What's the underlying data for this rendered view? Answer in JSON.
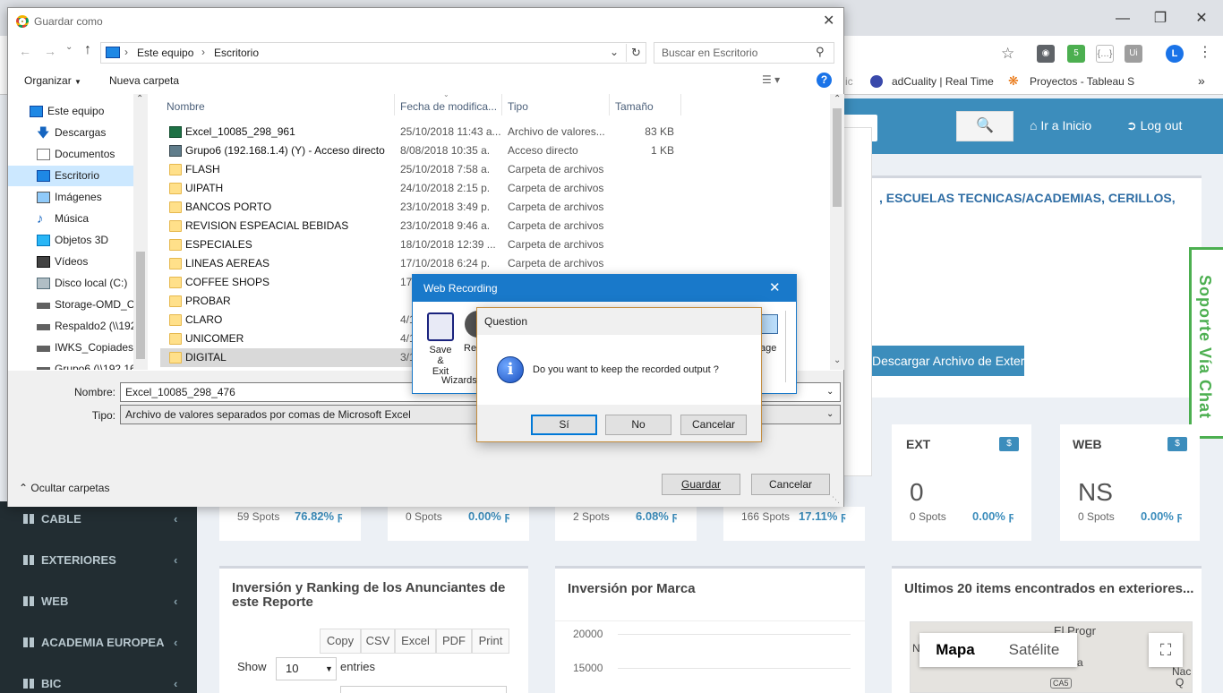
{
  "browser": {
    "bookmarks": [
      "ic",
      "adCuality | Real Time",
      "Proyectos - Tableau S"
    ],
    "extension_badge": "5",
    "profile_initial": "L",
    "nav_home": "Ir a Inicio",
    "nav_logout": "Log out"
  },
  "site": {
    "categories_text": ", ESCUELAS TECNICAS/ACADEMIAS, CERILLOS,",
    "download_button": "Descargar Archivo de Exter",
    "chat_label": "Soporte Vía Chat",
    "sidebar": [
      "CABLE",
      "EXTERIORES",
      "WEB",
      "ACADEMIA EUROPEA",
      "BIC"
    ],
    "stats": [
      {
        "spots": "59 Spots",
        "pct": "76.82%"
      },
      {
        "spots": "0 Spots",
        "pct": "0.00%"
      },
      {
        "spots": "2 Spots",
        "pct": "6.08%"
      },
      {
        "spots": "166 Spots",
        "pct": "17.11%"
      }
    ],
    "ext_card": {
      "title": "EXT",
      "badge": "$",
      "value": "0",
      "spots": "0 Spots",
      "pct": "0.00%"
    },
    "web_card": {
      "title": "WEB",
      "badge": "$",
      "value": "NS",
      "spots": "0 Spots",
      "pct": "0.00%"
    },
    "panel1_title": "Inversión y Ranking de los Anunciantes de este Reporte",
    "export_buttons": [
      "Copy",
      "CSV",
      "Excel",
      "PDF",
      "Print"
    ],
    "show_label": "Show",
    "show_value": "10",
    "entries_label": "entries",
    "panel2_title": "Inversión por Marca",
    "panel2_ticks": [
      "20000",
      "15000"
    ],
    "panel3_title": "Ultimos 20 items encontrados en exteriores...",
    "map_tabs": [
      "Mapa",
      "Satélite"
    ],
    "map_labels": [
      "El Progr",
      "va",
      "Nac",
      "Q",
      "CA5",
      "N"
    ]
  },
  "save_dialog": {
    "title": "Guardar como",
    "breadcrumb": [
      "Este equipo",
      "Escritorio"
    ],
    "search_placeholder": "Buscar en Escritorio",
    "organize": "Organizar",
    "new_folder": "Nueva carpeta",
    "tree": [
      "Este equipo",
      "Descargas",
      "Documentos",
      "Escritorio",
      "Imágenes",
      "Música",
      "Objetos 3D",
      "Vídeos",
      "Disco local (C:)",
      "Storage-OMD_C",
      "Respaldo2 (\\\\192",
      "IWKS_Copiadese",
      "Grupo6 (\\\\192.16"
    ],
    "selected_tree": "Escritorio",
    "columns": [
      "Nombre",
      "Fecha de modifica...",
      "Tipo",
      "Tamaño"
    ],
    "files": [
      {
        "name": "Excel_10085_298_961",
        "date": "25/10/2018 11:43 a...",
        "type": "Archivo de valores...",
        "size": "83 KB",
        "icon": "excel-file-icon"
      },
      {
        "name": "Grupo6 (192.168.1.4) (Y) - Acceso directo",
        "date": "8/08/2018 10:35 a.",
        "type": "Acceso directo",
        "size": "1 KB",
        "icon": "shortcut-icon"
      },
      {
        "name": "FLASH",
        "date": "25/10/2018 7:58 a.",
        "type": "Carpeta de archivos",
        "size": "",
        "icon": "folder-icon"
      },
      {
        "name": "UIPATH",
        "date": "24/10/2018 2:15 p.",
        "type": "Carpeta de archivos",
        "size": "",
        "icon": "folder-icon"
      },
      {
        "name": "BANCOS PORTO",
        "date": "23/10/2018 3:49 p.",
        "type": "Carpeta de archivos",
        "size": "",
        "icon": "folder-icon"
      },
      {
        "name": "REVISION ESPEACIAL BEBIDAS",
        "date": "23/10/2018 9:46 a.",
        "type": "Carpeta de archivos",
        "size": "",
        "icon": "folder-icon"
      },
      {
        "name": "ESPECIALES",
        "date": "18/10/2018 12:39 ...",
        "type": "Carpeta de archivos",
        "size": "",
        "icon": "folder-icon"
      },
      {
        "name": "LINEAS AEREAS",
        "date": "17/10/2018 6:24 p.",
        "type": "Carpeta de archivos",
        "size": "",
        "icon": "folder-icon"
      },
      {
        "name": "COFFEE SHOPS",
        "date": "17/",
        "type": "",
        "size": "",
        "icon": "folder-icon"
      },
      {
        "name": "PROBAR",
        "date": "",
        "type": "",
        "size": "",
        "icon": "folder-icon"
      },
      {
        "name": "CLARO",
        "date": "4/1",
        "type": "",
        "size": "",
        "icon": "folder-icon"
      },
      {
        "name": "UNICOMER",
        "date": "4/1",
        "type": "",
        "size": "",
        "icon": "folder-icon"
      },
      {
        "name": "DIGITAL",
        "date": "3/1",
        "type": "",
        "size": "",
        "icon": "folder-icon"
      }
    ],
    "filename_label": "Nombre:",
    "filename_value": "Excel_10085_298_476",
    "type_label": "Tipo:",
    "type_value": "Archivo de valores separados por comas de Microsoft Excel",
    "hide_folders": "Ocultar carpetas",
    "save_button": "Guardar",
    "cancel_button": "Cancelar"
  },
  "web_recording": {
    "title": "Web Recording",
    "save_exit_line1": "Save",
    "save_exit_line2": "& Exit",
    "rec_label": "Rec",
    "wizards_label": "Wizards",
    "image_label": "age"
  },
  "question": {
    "title": "Question",
    "message": "Do you want to keep the recorded output ?",
    "yes": "Sí",
    "no": "No",
    "cancel": "Cancelar"
  },
  "colors": {
    "accent": "#3c8dbc",
    "sidebar_bg": "#222d32",
    "recording_titlebar": "#1979ca",
    "chat_green": "#4caf50"
  }
}
